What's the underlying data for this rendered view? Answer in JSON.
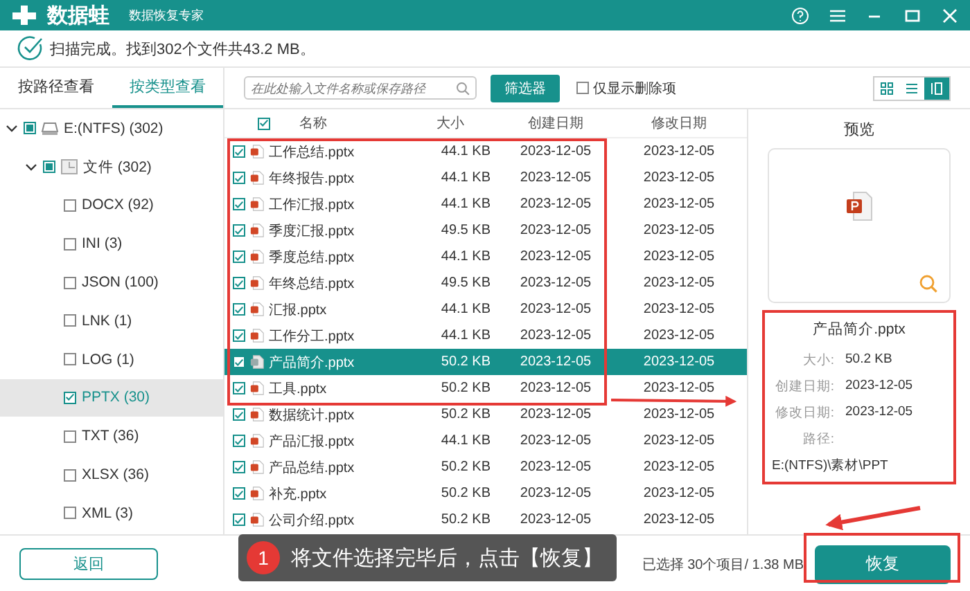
{
  "window": {
    "app_name": "数据蛙",
    "subtitle": "数据恢复专家"
  },
  "scan_status": "扫描完成。找到302个文件共43.2 MB。",
  "view_tabs": [
    {
      "label": "按路径查看",
      "selected": false
    },
    {
      "label": "按类型查看",
      "selected": true
    }
  ],
  "search": {
    "placeholder": "在此处输入文件名称或保存路径"
  },
  "filter_button": "筛选器",
  "deleted_only": {
    "label": "仅显示删除项",
    "checked": false
  },
  "view_modes": [
    {
      "kind": "grid",
      "selected": false
    },
    {
      "kind": "list",
      "selected": false
    },
    {
      "kind": "preview",
      "selected": true
    }
  ],
  "tree": [
    {
      "label": "E:(NTFS) (302)",
      "kind": "drive",
      "expanded": true,
      "checked": false,
      "partial": true,
      "selected": false,
      "children": [
        {
          "label": "文件 (302)",
          "kind": "folder",
          "expanded": true,
          "checked": false,
          "partial": true,
          "selected": false,
          "children": [
            {
              "label": "DOCX (92)",
              "checked": false,
              "selected": false
            },
            {
              "label": "INI (3)",
              "checked": false,
              "selected": false
            },
            {
              "label": "JSON (100)",
              "checked": false,
              "selected": false
            },
            {
              "label": "LNK (1)",
              "checked": false,
              "selected": false
            },
            {
              "label": "LOG (1)",
              "checked": false,
              "selected": false
            },
            {
              "label": "PPTX (30)",
              "checked": true,
              "selected": true
            },
            {
              "label": "TXT (36)",
              "checked": false,
              "selected": false
            },
            {
              "label": "XLSX (36)",
              "checked": false,
              "selected": false
            },
            {
              "label": "XML (3)",
              "checked": false,
              "selected": false
            }
          ]
        }
      ]
    }
  ],
  "table": {
    "all_checked": true,
    "columns": [
      "名称",
      "大小",
      "创建日期",
      "修改日期"
    ],
    "rows": [
      {
        "name": "工作总结.pptx",
        "size": "44.1 KB",
        "created": "2023-12-05",
        "modified": "2023-12-05",
        "checked": true,
        "selected": false
      },
      {
        "name": "年终报告.pptx",
        "size": "44.1 KB",
        "created": "2023-12-05",
        "modified": "2023-12-05",
        "checked": true,
        "selected": false
      },
      {
        "name": "工作汇报.pptx",
        "size": "44.1 KB",
        "created": "2023-12-05",
        "modified": "2023-12-05",
        "checked": true,
        "selected": false
      },
      {
        "name": "季度汇报.pptx",
        "size": "49.5 KB",
        "created": "2023-12-05",
        "modified": "2023-12-05",
        "checked": true,
        "selected": false
      },
      {
        "name": "季度总结.pptx",
        "size": "44.1 KB",
        "created": "2023-12-05",
        "modified": "2023-12-05",
        "checked": true,
        "selected": false
      },
      {
        "name": "年终总结.pptx",
        "size": "49.5 KB",
        "created": "2023-12-05",
        "modified": "2023-12-05",
        "checked": true,
        "selected": false
      },
      {
        "name": "汇报.pptx",
        "size": "44.1 KB",
        "created": "2023-12-05",
        "modified": "2023-12-05",
        "checked": true,
        "selected": false
      },
      {
        "name": "工作分工.pptx",
        "size": "44.1 KB",
        "created": "2023-12-05",
        "modified": "2023-12-05",
        "checked": true,
        "selected": false
      },
      {
        "name": "产品简介.pptx",
        "size": "50.2 KB",
        "created": "2023-12-05",
        "modified": "2023-12-05",
        "checked": true,
        "selected": true
      },
      {
        "name": "工具.pptx",
        "size": "50.2 KB",
        "created": "2023-12-05",
        "modified": "2023-12-05",
        "checked": true,
        "selected": false
      },
      {
        "name": "数据统计.pptx",
        "size": "50.2 KB",
        "created": "2023-12-05",
        "modified": "2023-12-05",
        "checked": true,
        "selected": false
      },
      {
        "name": "产品汇报.pptx",
        "size": "44.1 KB",
        "created": "2023-12-05",
        "modified": "2023-12-05",
        "checked": true,
        "selected": false
      },
      {
        "name": "产品总结.pptx",
        "size": "50.2 KB",
        "created": "2023-12-05",
        "modified": "2023-12-05",
        "checked": true,
        "selected": false
      },
      {
        "name": "补充.pptx",
        "size": "50.2 KB",
        "created": "2023-12-05",
        "modified": "2023-12-05",
        "checked": true,
        "selected": false
      },
      {
        "name": "公司介绍.pptx",
        "size": "50.2 KB",
        "created": "2023-12-05",
        "modified": "2023-12-05",
        "checked": true,
        "selected": false
      }
    ]
  },
  "preview": {
    "title": "预览",
    "file_name": "产品简介.pptx",
    "fields": [
      {
        "label": "大小:",
        "value": "50.2 KB"
      },
      {
        "label": "创建日期:",
        "value": "2023-12-05"
      },
      {
        "label": "修改日期:",
        "value": "2023-12-05"
      }
    ],
    "path_label": "路径:",
    "path": "E:(NTFS)\\素材\\PPT"
  },
  "back_button": "返回",
  "selection_status": "已选择 30个项目/ 1.38 MB",
  "recover_button": "恢复",
  "callout": {
    "step": "1",
    "text": "将文件选择完毕后，点击【恢复】"
  }
}
